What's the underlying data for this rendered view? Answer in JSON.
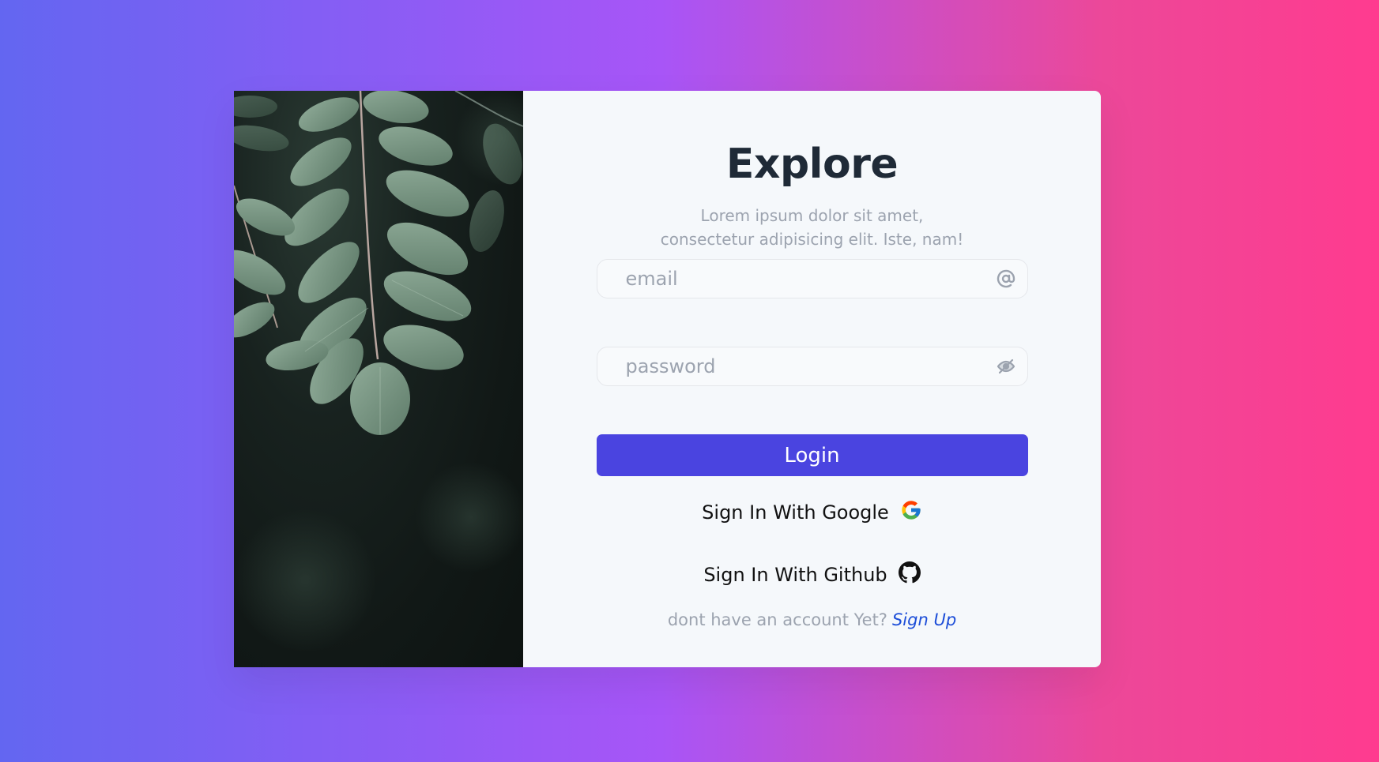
{
  "colors": {
    "background_start": "#6366f1",
    "background_mid": "#a855f7",
    "background_end": "#ff3b8f",
    "panel": "#f5f8fb",
    "title": "#1f2a37",
    "muted": "#9ca3af",
    "primary": "#4a44e0",
    "link": "#1d4ed8"
  },
  "hero": {
    "image": "leaves-photo"
  },
  "form": {
    "title": "Explore",
    "subtitle_line1": "Lorem ipsum dolor sit amet,",
    "subtitle_line2": "consectetur adipisicing elit. Iste, nam!",
    "email": {
      "placeholder": "email",
      "icon": "at-icon"
    },
    "password": {
      "placeholder": "password",
      "icon": "eye-slash-icon"
    },
    "login_label": "Login",
    "google_label": "Sign In With Google",
    "github_label": "Sign In With Github",
    "signup_prompt": "dont have an account Yet?",
    "signup_link": "Sign Up"
  }
}
